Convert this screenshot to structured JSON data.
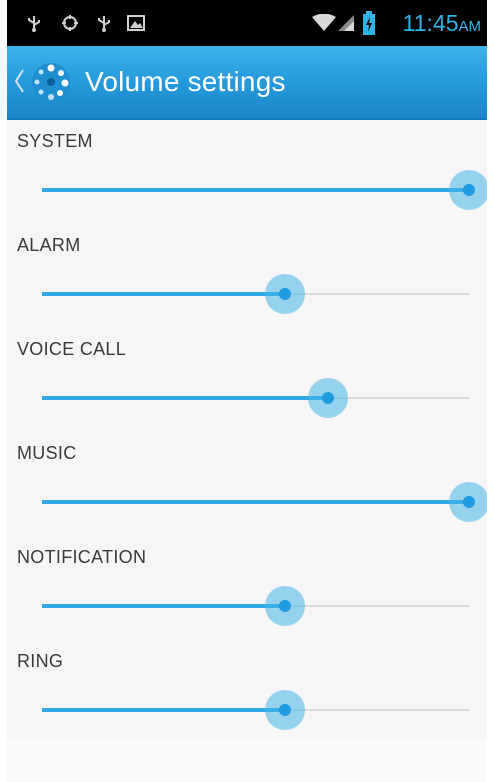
{
  "status_bar": {
    "time": "11:45",
    "ampm": "AM",
    "left_icons": [
      "usb-icon",
      "android-debug-icon",
      "usb-icon",
      "image-notification-icon"
    ],
    "right_icons": [
      "wifi-icon",
      "signal-icon",
      "battery-charging-icon"
    ]
  },
  "action_bar": {
    "title": "Volume settings",
    "back_icon": "back-caret-icon",
    "app_icon": "volume-app-icon"
  },
  "settings": [
    {
      "label": "SYSTEM",
      "level": 1.0
    },
    {
      "label": "ALARM",
      "level": 0.57
    },
    {
      "label": "VOICE CALL",
      "level": 0.67
    },
    {
      "label": "MUSIC",
      "level": 1.0
    },
    {
      "label": "NOTIFICATION",
      "level": 0.57
    },
    {
      "label": "RING",
      "level": 0.57
    }
  ],
  "colors": {
    "accent": "#2fa8e4",
    "action_bar": "#2398da",
    "status_bar": "#000000",
    "clock": "#2db4e8",
    "background": "#f6f6f6"
  }
}
